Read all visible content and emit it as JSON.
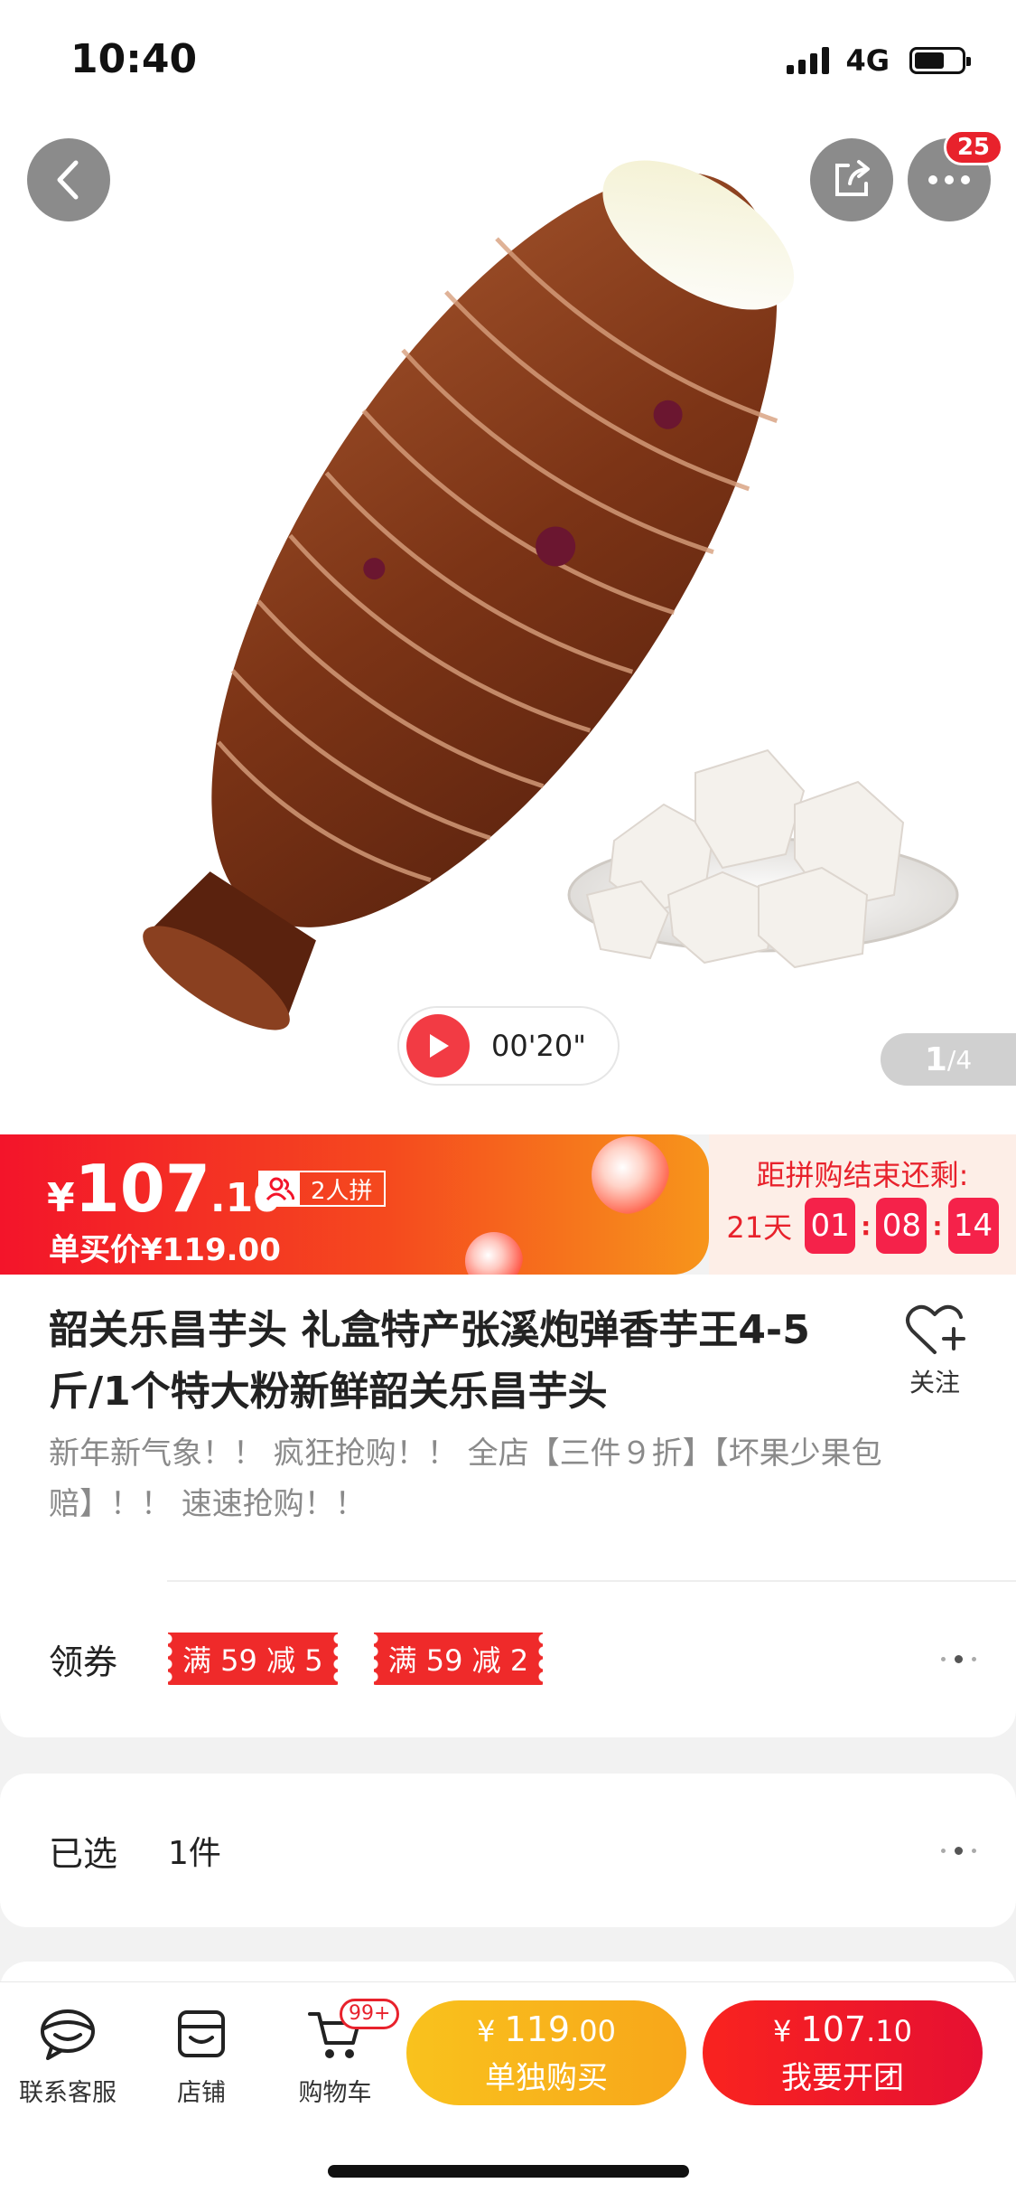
{
  "status": {
    "time": "10:40",
    "network": "4G"
  },
  "hero": {
    "cart_count": "25",
    "video_time": "00'20\"",
    "page_current": "1",
    "page_total": "/4"
  },
  "price": {
    "yen": "¥",
    "integer": "107",
    "decimal": ".10",
    "group_tag": "2人拼",
    "single_price": "单买价¥119.00"
  },
  "countdown": {
    "title": "距拼购结束还剩:",
    "days": "21天",
    "hours": "01",
    "minutes": "08",
    "seconds": "14"
  },
  "product": {
    "title": "韶关乐昌芋头 礼盒特产张溪炮弹香芋王4-5斤/1个特大粉新鲜韶关乐昌芋头",
    "follow_label": "关注",
    "promo": "新年新气象！！ 疯狂抢购！！ 全店【三件９折】【坏果少果包赔】！！ 速速抢购！！"
  },
  "coupons": {
    "label": "领券",
    "items": [
      "满 59 减 5",
      "满 59 减 2"
    ]
  },
  "selection": {
    "label": "已选",
    "value": "1件"
  },
  "bottom_bar": {
    "service_label": "联系客服",
    "store_label": "店铺",
    "cart_label": "购物车",
    "cart_badge": "99+",
    "single_buy": {
      "yen": "¥ ",
      "price_int": "119",
      "price_dec": ".00",
      "label": "单独购买"
    },
    "group_buy": {
      "yen": "¥ ",
      "price_int": "107",
      "price_dec": ".10",
      "label": "我要开团"
    }
  },
  "colors": {
    "accent_red": "#e8222c",
    "accent_orange": "#f8a61a",
    "countdown_bg": "#fdeee7"
  }
}
